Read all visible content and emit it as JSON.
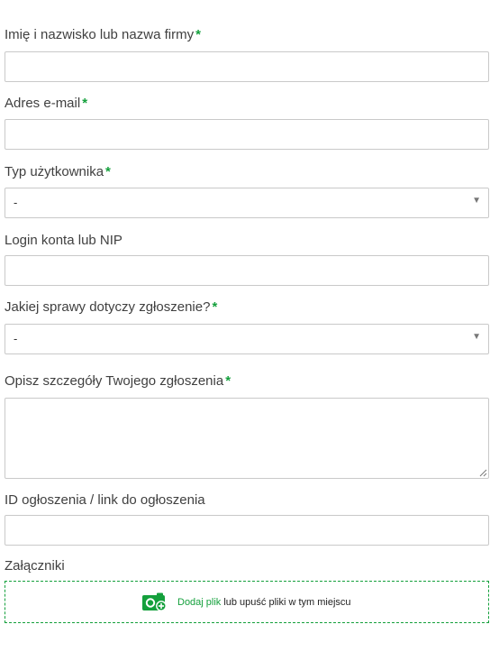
{
  "form": {
    "name": {
      "label": "Imię i nazwisko lub nazwa firmy",
      "required_mark": "*",
      "value": ""
    },
    "email": {
      "label": "Adres e-mail",
      "required_mark": "*",
      "value": ""
    },
    "user_type": {
      "label": "Typ użytkownika",
      "required_mark": "*",
      "selected": "-"
    },
    "login": {
      "label": "Login konta lub NIP",
      "value": ""
    },
    "topic": {
      "label": "Jakiej sprawy dotyczy zgłoszenie?",
      "required_mark": "*",
      "selected": "-"
    },
    "details": {
      "label": "Opisz szczegóły Twojego zgłoszenia",
      "required_mark": "*",
      "value": ""
    },
    "ad_id": {
      "label": "ID ogłoszenia / link do ogłoszenia",
      "value": ""
    },
    "attachments": {
      "label": "Załączniki",
      "add_file_link": "Dodaj plik",
      "drop_text": "lub upuść pliki w tym miejscu",
      "icon": "add-file-camera-icon"
    }
  },
  "colors": {
    "accent": "#14a03c",
    "border": "#c9c9c9",
    "label": "#404040"
  }
}
